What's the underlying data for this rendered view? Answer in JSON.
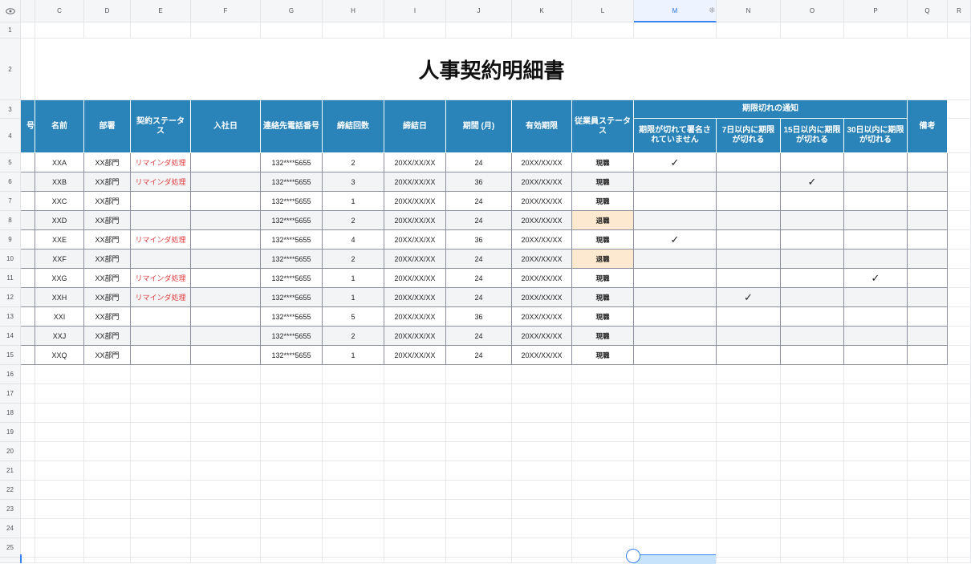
{
  "sheet": {
    "columns": [
      "C",
      "D",
      "E",
      "F",
      "G",
      "H",
      "I",
      "J",
      "K",
      "L",
      "M",
      "N",
      "O",
      "P",
      "Q",
      "R"
    ],
    "selected_column": "M",
    "row_numbers": [
      "1",
      "2",
      "3",
      "4",
      "5",
      "6",
      "7",
      "8",
      "9",
      "10",
      "11",
      "12",
      "13",
      "14",
      "15",
      "16",
      "17",
      "18",
      "19",
      "20",
      "21",
      "22",
      "23",
      "24",
      "25"
    ],
    "title": "人事契約明細書",
    "headers": {
      "partial_number": "号",
      "name": "名前",
      "department": "部署",
      "contract_status": "契約ステータス",
      "hire_date": "入社日",
      "phone": "連絡先電話番号",
      "contract_count": "締結回数",
      "contract_date": "締結日",
      "period": "期間 (月)",
      "expiry": "有効期限",
      "employee_status": "従業員ステータス",
      "notice_group": "期限切れの通知",
      "notice_unsigned": "期限が切れて署名されていません",
      "notice_7": "7日以内に期限が切れる",
      "notice_15": "15日以内に期限が切れる",
      "notice_30": "30日以内に期限が切れる",
      "remarks": "備考"
    },
    "rows": [
      {
        "name": "XXA",
        "department": "XX部門",
        "status": "リマインダ処理",
        "phone": "132****5655",
        "count": "2",
        "date": "20XX/XX/XX",
        "period": "24",
        "expiry": "20XX/XX/XX",
        "employee_status": "現職",
        "notice": 0
      },
      {
        "name": "XXB",
        "department": "XX部門",
        "status": "リマインダ処理",
        "phone": "132****5655",
        "count": "3",
        "date": "20XX/XX/XX",
        "period": "36",
        "expiry": "20XX/XX/XX",
        "employee_status": "現職",
        "notice": 2
      },
      {
        "name": "XXC",
        "department": "XX部門",
        "status": "",
        "phone": "132****5655",
        "count": "1",
        "date": "20XX/XX/XX",
        "period": "24",
        "expiry": "20XX/XX/XX",
        "employee_status": "現職",
        "notice": -1
      },
      {
        "name": "XXD",
        "department": "XX部門",
        "status": "",
        "phone": "132****5655",
        "count": "2",
        "date": "20XX/XX/XX",
        "period": "24",
        "expiry": "20XX/XX/XX",
        "employee_status": "退職",
        "notice": -1
      },
      {
        "name": "XXE",
        "department": "XX部門",
        "status": "リマインダ処理",
        "phone": "132****5655",
        "count": "4",
        "date": "20XX/XX/XX",
        "period": "36",
        "expiry": "20XX/XX/XX",
        "employee_status": "現職",
        "notice": 0
      },
      {
        "name": "XXF",
        "department": "XX部門",
        "status": "",
        "phone": "132****5655",
        "count": "2",
        "date": "20XX/XX/XX",
        "period": "24",
        "expiry": "20XX/XX/XX",
        "employee_status": "退職",
        "notice": -1
      },
      {
        "name": "XXG",
        "department": "XX部門",
        "status": "リマインダ処理",
        "phone": "132****5655",
        "count": "1",
        "date": "20XX/XX/XX",
        "period": "24",
        "expiry": "20XX/XX/XX",
        "employee_status": "現職",
        "notice": 3
      },
      {
        "name": "XXH",
        "department": "XX部門",
        "status": "リマインダ処理",
        "phone": "132****5655",
        "count": "1",
        "date": "20XX/XX/XX",
        "period": "24",
        "expiry": "20XX/XX/XX",
        "employee_status": "現職",
        "notice": 1
      },
      {
        "name": "XXI",
        "department": "XX部門",
        "status": "",
        "phone": "132****5655",
        "count": "5",
        "date": "20XX/XX/XX",
        "period": "36",
        "expiry": "20XX/XX/XX",
        "employee_status": "現職",
        "notice": -1
      },
      {
        "name": "XXJ",
        "department": "XX部門",
        "status": "",
        "phone": "132****5655",
        "count": "2",
        "date": "20XX/XX/XX",
        "period": "24",
        "expiry": "20XX/XX/XX",
        "employee_status": "現職",
        "notice": -1
      },
      {
        "name": "XXQ",
        "department": "XX部門",
        "status": "",
        "phone": "132****5655",
        "count": "1",
        "date": "20XX/XX/XX",
        "period": "24",
        "expiry": "20XX/XX/XX",
        "employee_status": "現職",
        "notice": -1
      }
    ],
    "check_mark": "✓",
    "leaving_status": "退職",
    "leave_highlight_color": "#fde9d0",
    "header_color": "#2a83b9",
    "reminder_color": "#e03c3c",
    "icons": {
      "corner": "eye-icon",
      "freeze": "freeze-handle-icon"
    }
  }
}
